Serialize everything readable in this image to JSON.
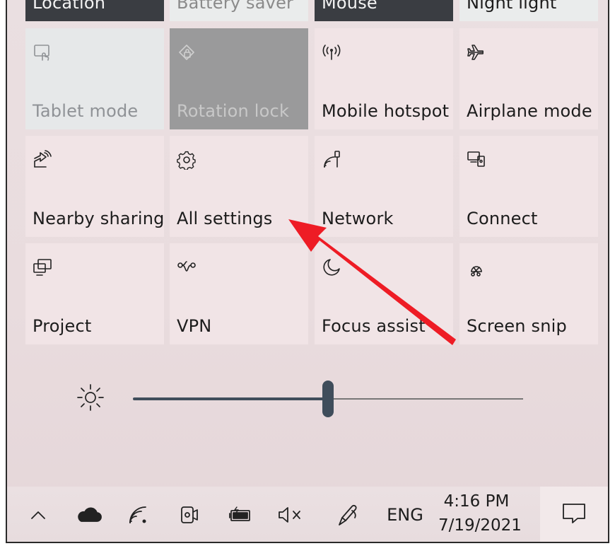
{
  "top_row": [
    {
      "label": "Location",
      "icon": "location-icon"
    },
    {
      "label": "Battery saver",
      "icon": "battery-saver-icon"
    },
    {
      "label": "Mouse",
      "icon": "mouse-icon"
    },
    {
      "label": "Night light",
      "icon": "night-light-icon"
    }
  ],
  "tiles": [
    {
      "label": "Tablet mode",
      "icon": "tablet-mode-icon",
      "state": "inactive"
    },
    {
      "label": "Rotation lock",
      "icon": "rotation-lock-icon",
      "state": "disabled"
    },
    {
      "label": "Mobile hotspot",
      "icon": "hotspot-icon",
      "state": "off"
    },
    {
      "label": "Airplane mode",
      "icon": "airplane-icon",
      "state": "off"
    },
    {
      "label": "Nearby sharing",
      "icon": "nearby-sharing-icon",
      "state": "off"
    },
    {
      "label": "All settings",
      "icon": "gear-icon",
      "state": "off"
    },
    {
      "label": "Network",
      "icon": "network-icon",
      "state": "off"
    },
    {
      "label": "Connect",
      "icon": "connect-icon",
      "state": "off"
    },
    {
      "label": "Project",
      "icon": "project-icon",
      "state": "off"
    },
    {
      "label": "VPN",
      "icon": "vpn-icon",
      "state": "off"
    },
    {
      "label": "Focus assist",
      "icon": "moon-icon",
      "state": "off"
    },
    {
      "label": "Screen snip",
      "icon": "screen-snip-icon",
      "state": "off"
    }
  ],
  "brightness": {
    "value_percent": 50,
    "icon": "sun-icon"
  },
  "taskbar": {
    "icons": [
      "chevron-up-icon",
      "cloud-icon",
      "wifi-icon",
      "camera-icon",
      "battery-icon",
      "volume-muted-icon",
      "pen-icon"
    ],
    "language": "ENG",
    "time": "4:16 PM",
    "date": "7/19/2021",
    "notification_icon": "notification-icon"
  },
  "annotation": {
    "color": "#ee1c25",
    "points_to": "All settings"
  }
}
